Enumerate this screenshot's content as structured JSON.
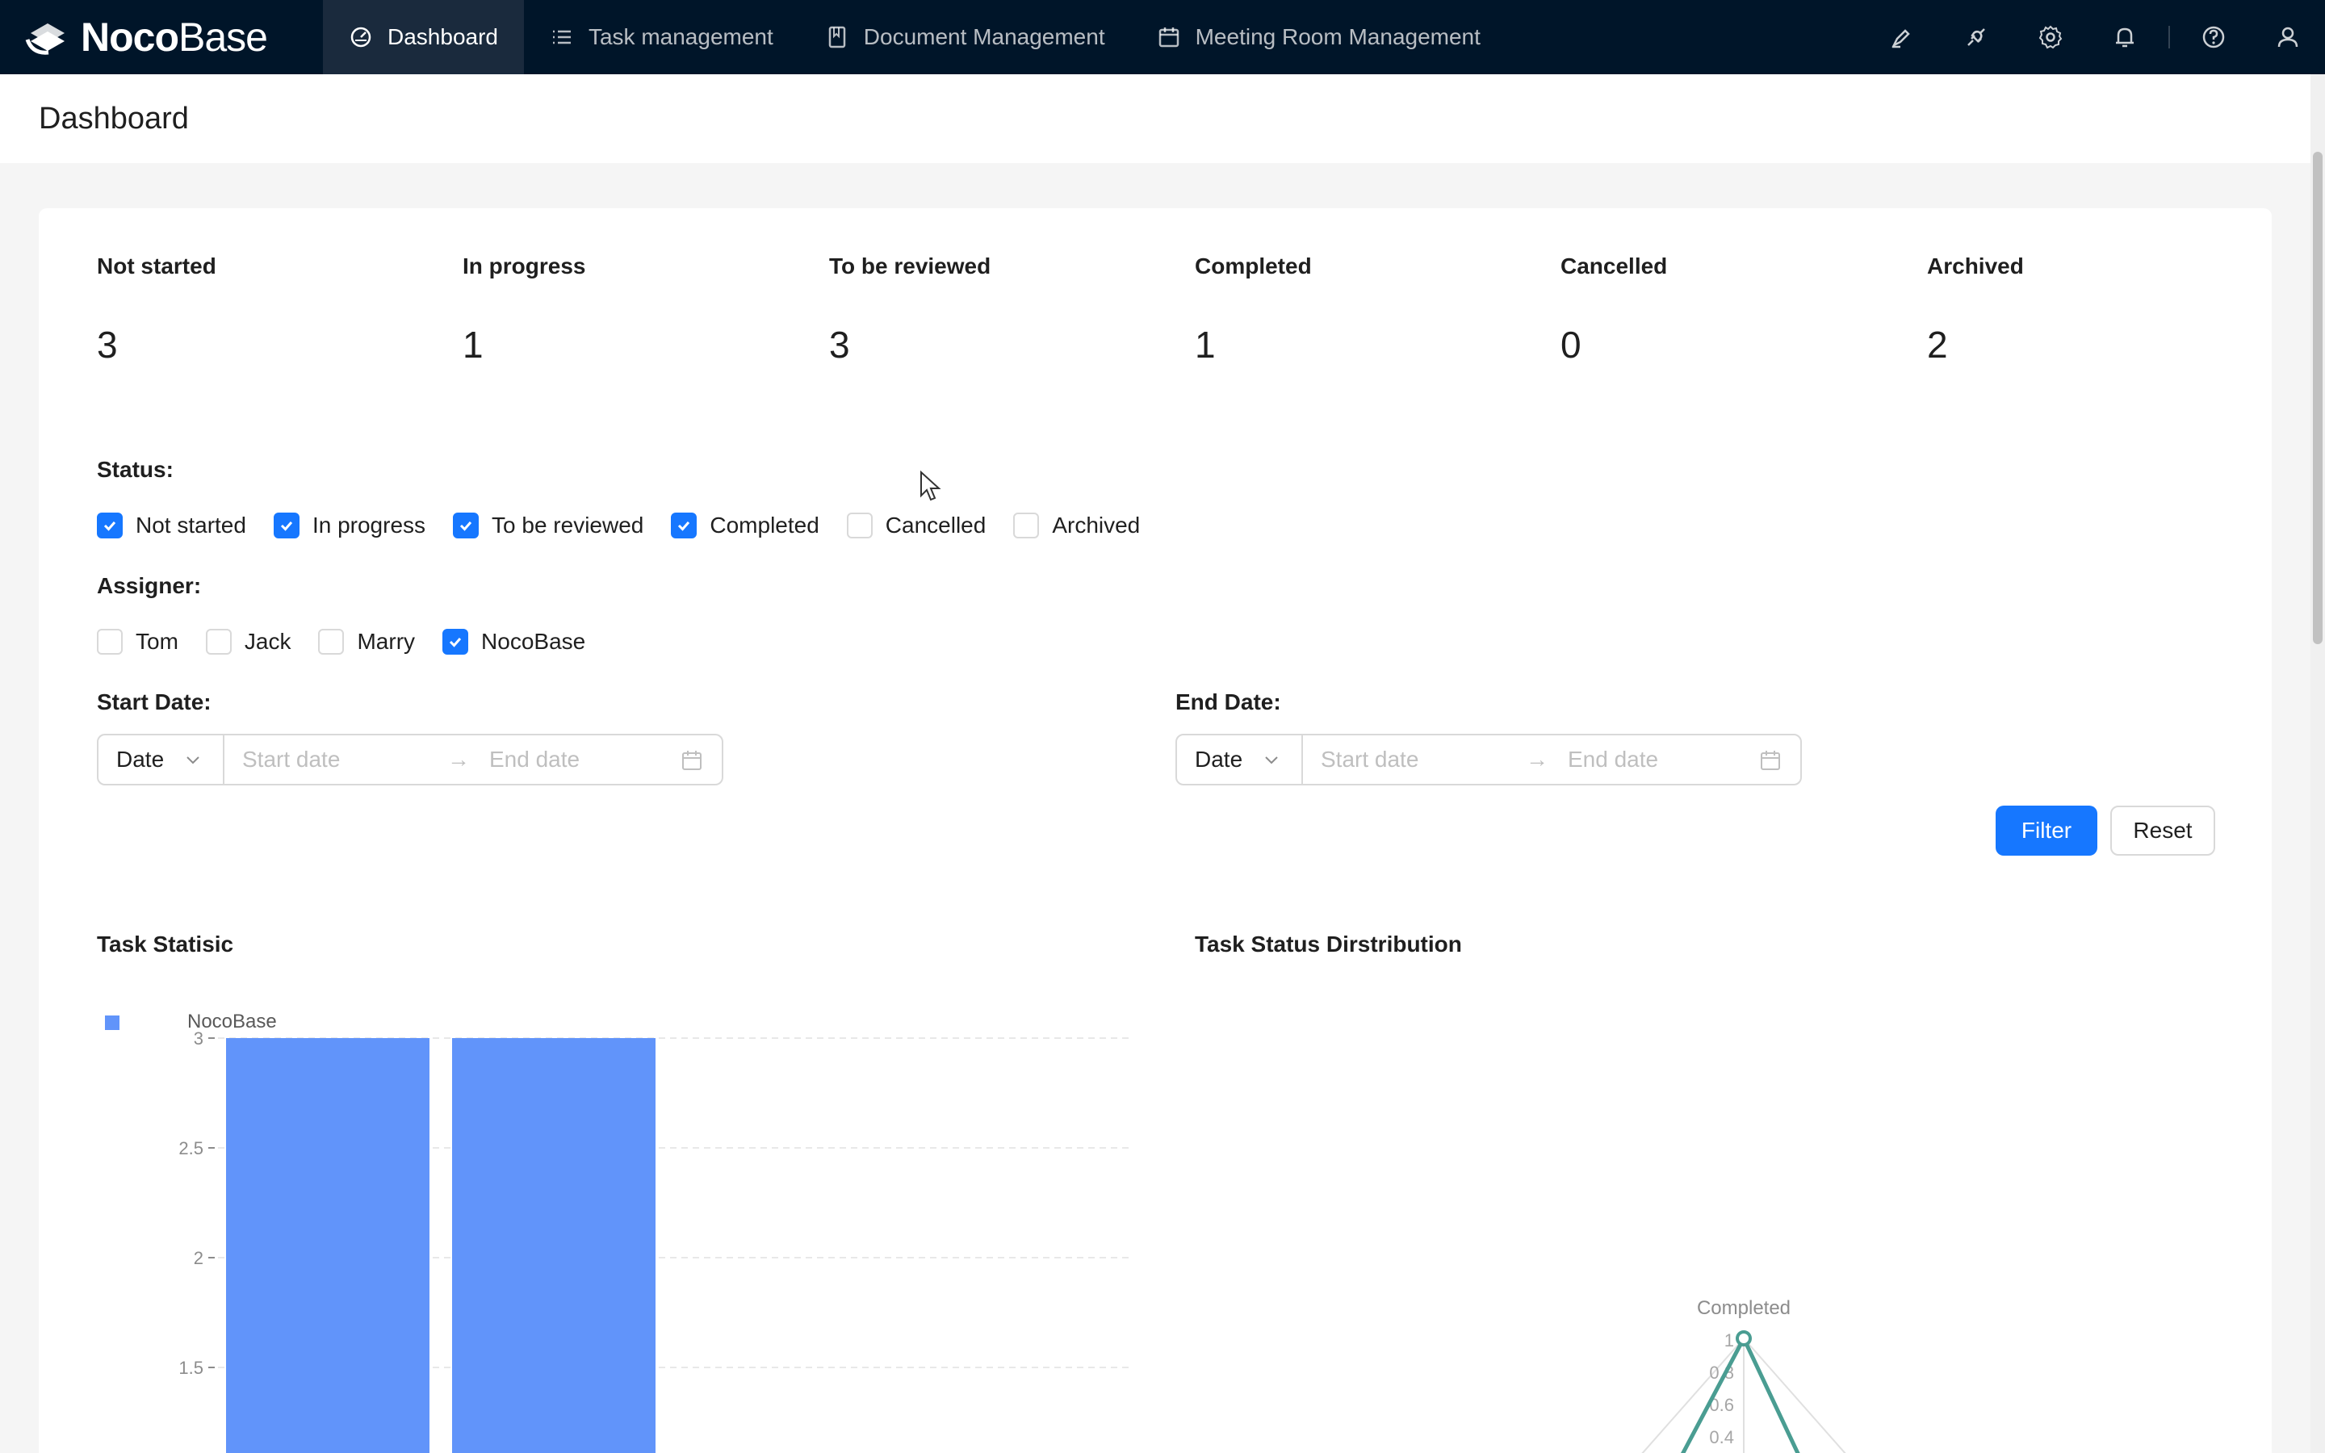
{
  "app": {
    "logo_bold": "Noco",
    "logo_light": "Base"
  },
  "nav": {
    "items": [
      {
        "label": "Dashboard",
        "icon": "dashboard-icon",
        "active": true
      },
      {
        "label": "Task management",
        "icon": "list-icon",
        "active": false
      },
      {
        "label": "Document Management",
        "icon": "book-icon",
        "active": false
      },
      {
        "label": "Meeting Room Management",
        "icon": "calendar-icon",
        "active": false
      }
    ]
  },
  "tools": [
    "highlight-icon",
    "plugin-icon",
    "settings-icon",
    "bell-icon",
    "help-icon",
    "user-icon"
  ],
  "page": {
    "title": "Dashboard"
  },
  "stats": [
    {
      "label": "Not started",
      "value": "3"
    },
    {
      "label": "In progress",
      "value": "1"
    },
    {
      "label": "To be reviewed",
      "value": "3"
    },
    {
      "label": "Completed",
      "value": "1"
    },
    {
      "label": "Cancelled",
      "value": "0"
    },
    {
      "label": "Archived",
      "value": "2"
    }
  ],
  "filter": {
    "status_label": "Status",
    "status_options": [
      {
        "label": "Not started",
        "checked": true
      },
      {
        "label": "In progress",
        "checked": true
      },
      {
        "label": "To be reviewed",
        "checked": true
      },
      {
        "label": "Completed",
        "checked": true
      },
      {
        "label": "Cancelled",
        "checked": false
      },
      {
        "label": "Archived",
        "checked": false
      }
    ],
    "assigner_label": "Assigner",
    "assigner_options": [
      {
        "label": "Tom",
        "checked": false
      },
      {
        "label": "Jack",
        "checked": false
      },
      {
        "label": "Marry",
        "checked": false
      },
      {
        "label": "NocoBase",
        "checked": true
      }
    ],
    "start_date": {
      "label": "Start Date",
      "picker": "Date",
      "start_placeholder": "Start date",
      "end_placeholder": "End date"
    },
    "end_date": {
      "label": "End Date",
      "picker": "Date",
      "start_placeholder": "Start date",
      "end_placeholder": "End date"
    },
    "filter_button": "Filter",
    "reset_button": "Reset"
  },
  "colors": {
    "nav_bg": "#001529",
    "primary": "#1677ff",
    "bar": "#6194fa",
    "radar": "#4a9d92"
  },
  "chart_data": [
    {
      "type": "bar",
      "title": "Task Statisic",
      "series": [
        {
          "name": "NocoBase",
          "values": [
            3,
            3
          ]
        }
      ],
      "yticks": [
        "3",
        "2.5",
        "2",
        "1.5"
      ],
      "ylim": [
        1.5,
        3
      ],
      "grid": true,
      "legend": "top-left"
    },
    {
      "type": "radar",
      "title": "Task Status Dirstribution",
      "indicator": "Completed",
      "value": 1,
      "rticks": [
        "1",
        "0.8",
        "0.6",
        "0.4"
      ]
    }
  ]
}
